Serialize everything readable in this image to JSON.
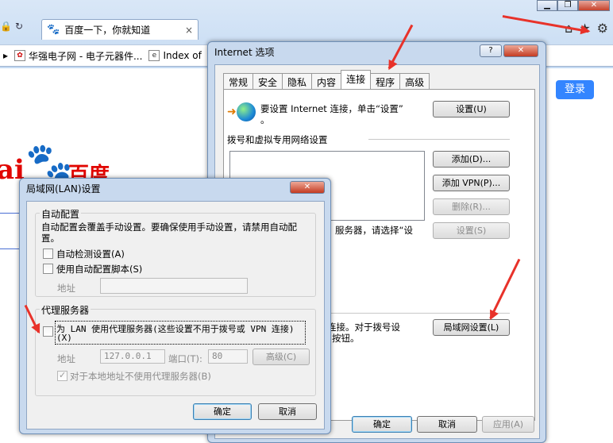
{
  "browser": {
    "tab_title": "百度一下，你就知道",
    "tab_close": "×",
    "favorites": [
      {
        "label": "华强电子网 - 电子元器件..."
      },
      {
        "label": "Index of"
      }
    ],
    "window_buttons": {
      "minimize": "▁",
      "maximize": "❐",
      "close": "✕"
    },
    "command_icons": {
      "home": "⌂",
      "favorites": "★",
      "tools": "⚙"
    }
  },
  "baidu": {
    "login_button": "登录",
    "logo_bai": "ai",
    "logo_paw": "🐾",
    "logo_du": "百度"
  },
  "internet_options": {
    "title": "Internet 选项",
    "help_btn": "?",
    "close_btn": "✕",
    "tabs": [
      "常规",
      "安全",
      "隐私",
      "内容",
      "连接",
      "程序",
      "高级"
    ],
    "active_tab": "连接",
    "setup_text_line1": "要设置 Internet 连接，单击“设置”",
    "setup_text_line2": "。",
    "setup_button": "设置(U)",
    "dialup_header": "拨号和虚拟专用网络设置",
    "add_button": "添加(D)...",
    "add_vpn_button": "添加 VPN(P)...",
    "remove_button": "删除(R)...",
    "settings_button": "设置(S)",
    "proxy_text_partial": "服务器，请选择“设",
    "lan_text_line1": "连接。对于拨号设",
    "lan_text_line2": "”按钮。",
    "lan_settings_button": "局域网设置(L)",
    "ok_button": "确定",
    "cancel_button": "取消",
    "apply_button": "应用(A)"
  },
  "lan_dialog": {
    "title": "局域网(LAN)设置",
    "close_btn": "✕",
    "auto_config_label": "自动配置",
    "auto_config_desc_line1": "自动配置会覆盖手动设置。要确保使用手动设置，请禁用自动配",
    "auto_config_desc_line2": "置。",
    "auto_detect_label": "自动检测设置(A)",
    "auto_detect_checked": false,
    "auto_script_label": "使用自动配置脚本(S)",
    "auto_script_checked": false,
    "address_label": "地址",
    "address_value": "",
    "proxy_group_label": "代理服务器",
    "use_proxy_label_line1": "为 LAN 使用代理服务器(这些设置不用于拨号或 VPN 连接)",
    "use_proxy_label_line2": "(X)",
    "use_proxy_checked": false,
    "proxy_address_label": "地址",
    "proxy_address_value": "127.0.0.1",
    "port_label": "端口(T):",
    "port_value": "80",
    "advanced_button": "高级(C)",
    "bypass_local_label": "对于本地地址不使用代理服务器(B)",
    "bypass_local_checked": true,
    "ok_button": "确定",
    "cancel_button": "取消"
  },
  "colors": {
    "annotation_arrow": "#e8322a",
    "dialog_frame": "#c8d9ee",
    "baidu_red": "#e10601",
    "baidu_blue": "#2932e1",
    "login_blue": "#3385ff"
  }
}
